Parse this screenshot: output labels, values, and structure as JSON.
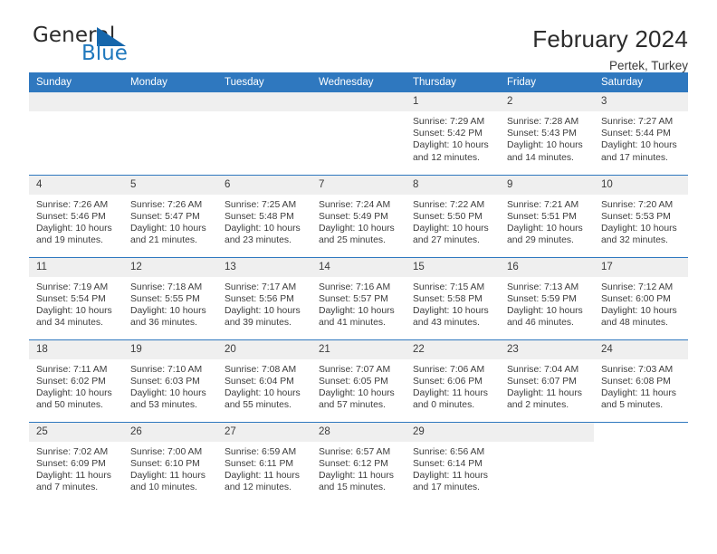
{
  "brand": {
    "name_top": "General",
    "name_bottom": "Blue",
    "color_blue": "#1f78bd",
    "color_dark": "#2b2b2b"
  },
  "header": {
    "title": "February 2024",
    "location": "Pertek, Turkey"
  },
  "theme": {
    "header_blue": "#2f78bf",
    "daynum_band": "#efefef",
    "text": "#3d3d3d"
  },
  "weekday_headers": [
    "Sunday",
    "Monday",
    "Tuesday",
    "Wednesday",
    "Thursday",
    "Friday",
    "Saturday"
  ],
  "labels": {
    "sunrise_prefix": "Sunrise:",
    "sunset_prefix": "Sunset:",
    "daylight_prefix": "Daylight:"
  },
  "weeks": [
    [
      {
        "day": "",
        "empty": true
      },
      {
        "day": "",
        "empty": true
      },
      {
        "day": "",
        "empty": true
      },
      {
        "day": "",
        "empty": true
      },
      {
        "day": "1",
        "sunrise": "Sunrise: 7:29 AM",
        "sunset": "Sunset: 5:42 PM",
        "daylight1": "Daylight: 10 hours",
        "daylight2": "and 12 minutes."
      },
      {
        "day": "2",
        "sunrise": "Sunrise: 7:28 AM",
        "sunset": "Sunset: 5:43 PM",
        "daylight1": "Daylight: 10 hours",
        "daylight2": "and 14 minutes."
      },
      {
        "day": "3",
        "sunrise": "Sunrise: 7:27 AM",
        "sunset": "Sunset: 5:44 PM",
        "daylight1": "Daylight: 10 hours",
        "daylight2": "and 17 minutes."
      }
    ],
    [
      {
        "day": "4",
        "sunrise": "Sunrise: 7:26 AM",
        "sunset": "Sunset: 5:46 PM",
        "daylight1": "Daylight: 10 hours",
        "daylight2": "and 19 minutes."
      },
      {
        "day": "5",
        "sunrise": "Sunrise: 7:26 AM",
        "sunset": "Sunset: 5:47 PM",
        "daylight1": "Daylight: 10 hours",
        "daylight2": "and 21 minutes."
      },
      {
        "day": "6",
        "sunrise": "Sunrise: 7:25 AM",
        "sunset": "Sunset: 5:48 PM",
        "daylight1": "Daylight: 10 hours",
        "daylight2": "and 23 minutes."
      },
      {
        "day": "7",
        "sunrise": "Sunrise: 7:24 AM",
        "sunset": "Sunset: 5:49 PM",
        "daylight1": "Daylight: 10 hours",
        "daylight2": "and 25 minutes."
      },
      {
        "day": "8",
        "sunrise": "Sunrise: 7:22 AM",
        "sunset": "Sunset: 5:50 PM",
        "daylight1": "Daylight: 10 hours",
        "daylight2": "and 27 minutes."
      },
      {
        "day": "9",
        "sunrise": "Sunrise: 7:21 AM",
        "sunset": "Sunset: 5:51 PM",
        "daylight1": "Daylight: 10 hours",
        "daylight2": "and 29 minutes."
      },
      {
        "day": "10",
        "sunrise": "Sunrise: 7:20 AM",
        "sunset": "Sunset: 5:53 PM",
        "daylight1": "Daylight: 10 hours",
        "daylight2": "and 32 minutes."
      }
    ],
    [
      {
        "day": "11",
        "sunrise": "Sunrise: 7:19 AM",
        "sunset": "Sunset: 5:54 PM",
        "daylight1": "Daylight: 10 hours",
        "daylight2": "and 34 minutes."
      },
      {
        "day": "12",
        "sunrise": "Sunrise: 7:18 AM",
        "sunset": "Sunset: 5:55 PM",
        "daylight1": "Daylight: 10 hours",
        "daylight2": "and 36 minutes."
      },
      {
        "day": "13",
        "sunrise": "Sunrise: 7:17 AM",
        "sunset": "Sunset: 5:56 PM",
        "daylight1": "Daylight: 10 hours",
        "daylight2": "and 39 minutes."
      },
      {
        "day": "14",
        "sunrise": "Sunrise: 7:16 AM",
        "sunset": "Sunset: 5:57 PM",
        "daylight1": "Daylight: 10 hours",
        "daylight2": "and 41 minutes."
      },
      {
        "day": "15",
        "sunrise": "Sunrise: 7:15 AM",
        "sunset": "Sunset: 5:58 PM",
        "daylight1": "Daylight: 10 hours",
        "daylight2": "and 43 minutes."
      },
      {
        "day": "16",
        "sunrise": "Sunrise: 7:13 AM",
        "sunset": "Sunset: 5:59 PM",
        "daylight1": "Daylight: 10 hours",
        "daylight2": "and 46 minutes."
      },
      {
        "day": "17",
        "sunrise": "Sunrise: 7:12 AM",
        "sunset": "Sunset: 6:00 PM",
        "daylight1": "Daylight: 10 hours",
        "daylight2": "and 48 minutes."
      }
    ],
    [
      {
        "day": "18",
        "sunrise": "Sunrise: 7:11 AM",
        "sunset": "Sunset: 6:02 PM",
        "daylight1": "Daylight: 10 hours",
        "daylight2": "and 50 minutes."
      },
      {
        "day": "19",
        "sunrise": "Sunrise: 7:10 AM",
        "sunset": "Sunset: 6:03 PM",
        "daylight1": "Daylight: 10 hours",
        "daylight2": "and 53 minutes."
      },
      {
        "day": "20",
        "sunrise": "Sunrise: 7:08 AM",
        "sunset": "Sunset: 6:04 PM",
        "daylight1": "Daylight: 10 hours",
        "daylight2": "and 55 minutes."
      },
      {
        "day": "21",
        "sunrise": "Sunrise: 7:07 AM",
        "sunset": "Sunset: 6:05 PM",
        "daylight1": "Daylight: 10 hours",
        "daylight2": "and 57 minutes."
      },
      {
        "day": "22",
        "sunrise": "Sunrise: 7:06 AM",
        "sunset": "Sunset: 6:06 PM",
        "daylight1": "Daylight: 11 hours",
        "daylight2": "and 0 minutes."
      },
      {
        "day": "23",
        "sunrise": "Sunrise: 7:04 AM",
        "sunset": "Sunset: 6:07 PM",
        "daylight1": "Daylight: 11 hours",
        "daylight2": "and 2 minutes."
      },
      {
        "day": "24",
        "sunrise": "Sunrise: 7:03 AM",
        "sunset": "Sunset: 6:08 PM",
        "daylight1": "Daylight: 11 hours",
        "daylight2": "and 5 minutes."
      }
    ],
    [
      {
        "day": "25",
        "sunrise": "Sunrise: 7:02 AM",
        "sunset": "Sunset: 6:09 PM",
        "daylight1": "Daylight: 11 hours",
        "daylight2": "and 7 minutes."
      },
      {
        "day": "26",
        "sunrise": "Sunrise: 7:00 AM",
        "sunset": "Sunset: 6:10 PM",
        "daylight1": "Daylight: 11 hours",
        "daylight2": "and 10 minutes."
      },
      {
        "day": "27",
        "sunrise": "Sunrise: 6:59 AM",
        "sunset": "Sunset: 6:11 PM",
        "daylight1": "Daylight: 11 hours",
        "daylight2": "and 12 minutes."
      },
      {
        "day": "28",
        "sunrise": "Sunrise: 6:57 AM",
        "sunset": "Sunset: 6:12 PM",
        "daylight1": "Daylight: 11 hours",
        "daylight2": "and 15 minutes."
      },
      {
        "day": "29",
        "sunrise": "Sunrise: 6:56 AM",
        "sunset": "Sunset: 6:14 PM",
        "daylight1": "Daylight: 11 hours",
        "daylight2": "and 17 minutes."
      },
      {
        "day": "",
        "empty": true
      },
      {
        "day": "",
        "blank": true
      }
    ]
  ]
}
